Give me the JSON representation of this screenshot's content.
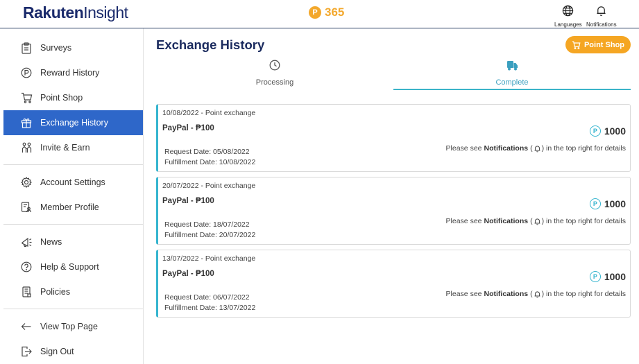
{
  "header": {
    "logo_part1": "Rakuten",
    "logo_part2": "Insight",
    "points_coin": "P",
    "points": "365",
    "languages_label": "Languages",
    "notifications_label": "Notifications"
  },
  "sidebar": {
    "groups": [
      [
        {
          "label": "Surveys",
          "icon": "clipboard-icon"
        },
        {
          "label": "Reward History",
          "icon": "points-circle-icon"
        },
        {
          "label": "Point Shop",
          "icon": "cart-icon"
        },
        {
          "label": "Exchange History",
          "icon": "gift-icon",
          "active": true
        },
        {
          "label": "Invite & Earn",
          "icon": "people-icon"
        }
      ],
      [
        {
          "label": "Account Settings",
          "icon": "gear-icon"
        },
        {
          "label": "Member Profile",
          "icon": "profile-doc-icon"
        }
      ],
      [
        {
          "label": "News",
          "icon": "megaphone-icon"
        },
        {
          "label": "Help & Support",
          "icon": "question-icon"
        },
        {
          "label": "Policies",
          "icon": "document-icon"
        }
      ],
      [
        {
          "label": "View Top Page",
          "icon": "arrow-left-icon"
        },
        {
          "label": "Sign Out",
          "icon": "sign-out-icon"
        }
      ]
    ]
  },
  "main": {
    "title": "Exchange History",
    "point_shop_button": "Point Shop",
    "tabs": [
      {
        "label": "Processing",
        "icon": "clock-icon"
      },
      {
        "label": "Complete",
        "icon": "truck-icon",
        "active": true
      }
    ],
    "exchanges": [
      {
        "date_line": "10/08/2022 - Point exchange",
        "item": "PayPal - ₱100",
        "request": "Request Date: 05/08/2022",
        "fulfillment": "Fulfillment Date: 10/08/2022",
        "points": "1000",
        "note_pre": "Please see",
        "note_bold": "Notifications",
        "note_post": "in the top right for details"
      },
      {
        "date_line": "20/07/2022 - Point exchange",
        "item": "PayPal - ₱100",
        "request": "Request Date: 18/07/2022",
        "fulfillment": "Fulfillment Date: 20/07/2022",
        "points": "1000",
        "note_pre": "Please see",
        "note_bold": "Notifications",
        "note_post": "in the top right for details"
      },
      {
        "date_line": "13/07/2022 - Point exchange",
        "item": "PayPal - ₱100",
        "request": "Request Date: 06/07/2022",
        "fulfillment": "Fulfillment Date: 13/07/2022",
        "points": "1000",
        "note_pre": "Please see",
        "note_bold": "Notifications",
        "note_post": "in the top right for details"
      }
    ]
  },
  "colors": {
    "brand_navy": "#1a2a6b",
    "active_blue": "#2e67c9",
    "accent_orange": "#f5a623",
    "accent_teal": "#36b5cf"
  }
}
